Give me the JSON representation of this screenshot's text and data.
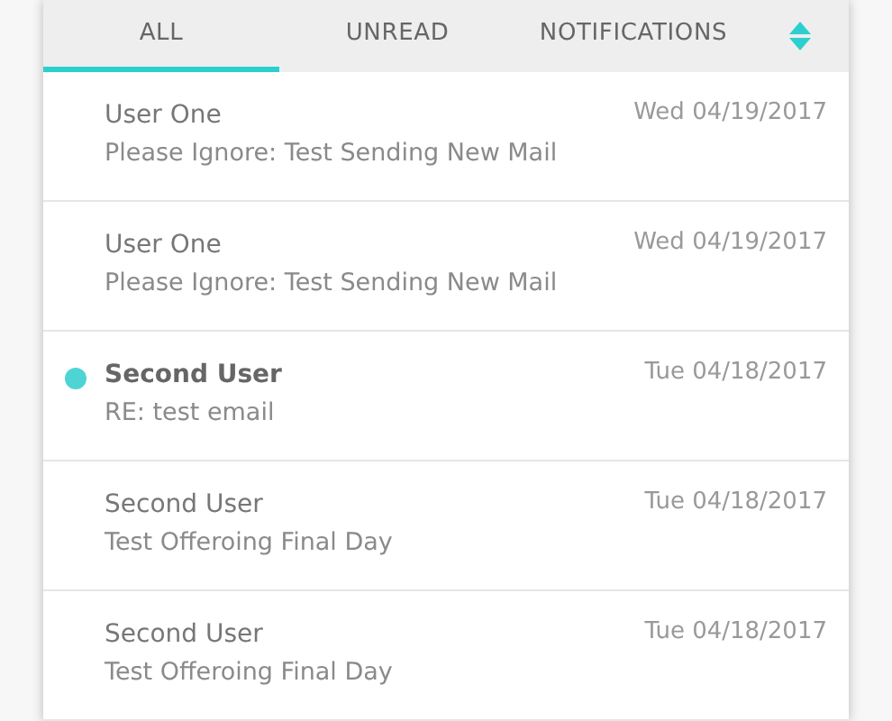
{
  "tabs": [
    {
      "label": "ALL",
      "selected": true
    },
    {
      "label": "UNREAD",
      "selected": false
    },
    {
      "label": "NOTIFICATIONS",
      "selected": false
    }
  ],
  "messages": [
    {
      "sender": "User One",
      "subject": "Please Ignore: Test Sending New Mail",
      "date": "Wed 04/19/2017",
      "unread": false
    },
    {
      "sender": "User One",
      "subject": "Please Ignore: Test Sending New Mail",
      "date": "Wed 04/19/2017",
      "unread": false
    },
    {
      "sender": "Second User",
      "subject": "RE: test email",
      "date": "Tue 04/18/2017",
      "unread": true
    },
    {
      "sender": "Second User",
      "subject": "Test Offeroing Final Day",
      "date": "Tue 04/18/2017",
      "unread": false
    },
    {
      "sender": "Second User",
      "subject": "Test Offeroing Final Day",
      "date": "Tue 04/18/2017",
      "unread": false
    }
  ]
}
